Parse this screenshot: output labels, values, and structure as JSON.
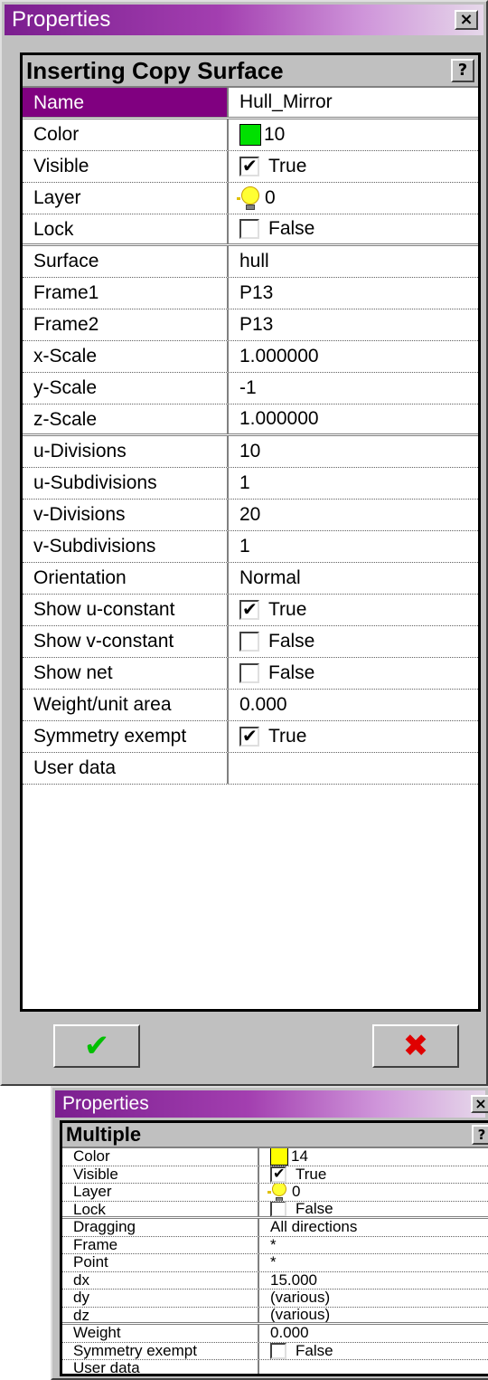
{
  "window1": {
    "title": "Properties",
    "close_label": "×",
    "header_title": "Inserting Copy Surface",
    "help_label": "?",
    "rows": [
      {
        "name": "Name",
        "value": "Hull_Mirror"
      },
      {
        "name": "Color",
        "value": "10",
        "swatch": "#00e000"
      },
      {
        "name": "Visible",
        "value": "True",
        "checked": true
      },
      {
        "name": "Layer",
        "value": "0"
      },
      {
        "name": "Lock",
        "value": "False",
        "checked": false
      },
      {
        "name": "Surface",
        "value": "hull"
      },
      {
        "name": "Frame1",
        "value": "P13"
      },
      {
        "name": "Frame2",
        "value": "P13"
      },
      {
        "name": "x-Scale",
        "value": "1.000000"
      },
      {
        "name": "y-Scale",
        "value": "-1"
      },
      {
        "name": "z-Scale",
        "value": "1.000000"
      },
      {
        "name": "u-Divisions",
        "value": "10"
      },
      {
        "name": "u-Subdivisions",
        "value": "1"
      },
      {
        "name": "v-Divisions",
        "value": "20"
      },
      {
        "name": "v-Subdivisions",
        "value": "1"
      },
      {
        "name": "Orientation",
        "value": "Normal"
      },
      {
        "name": "Show u-constant",
        "value": "True",
        "checked": true
      },
      {
        "name": "Show v-constant",
        "value": "False",
        "checked": false
      },
      {
        "name": "Show net",
        "value": "False",
        "checked": false
      },
      {
        "name": "Weight/unit area",
        "value": "0.000"
      },
      {
        "name": "Symmetry exempt",
        "value": "True",
        "checked": true
      },
      {
        "name": "User data",
        "value": ""
      }
    ],
    "ok_icon": "checkmark-icon",
    "cancel_icon": "x-icon",
    "ok_color": "#00c000",
    "cancel_color": "#e00000"
  },
  "window2": {
    "title": "Properties",
    "close_label": "×",
    "header_title": "Multiple",
    "help_label": "?",
    "rows": [
      {
        "name": "Color",
        "value": "14",
        "swatch": "#ffff00"
      },
      {
        "name": "Visible",
        "value": "True",
        "checked": true
      },
      {
        "name": "Layer",
        "value": "0"
      },
      {
        "name": "Lock",
        "value": "False",
        "checked": false
      },
      {
        "name": "Dragging",
        "value": "All directions"
      },
      {
        "name": "Frame",
        "value": "*"
      },
      {
        "name": "Point",
        "value": "*"
      },
      {
        "name": "dx",
        "value": "15.000"
      },
      {
        "name": "dy",
        "value": "(various)"
      },
      {
        "name": "dz",
        "value": "(various)"
      },
      {
        "name": "Weight",
        "value": "0.000"
      },
      {
        "name": "Symmetry exempt",
        "value": "False",
        "checked": false
      },
      {
        "name": "User data",
        "value": ""
      }
    ]
  },
  "colors": {
    "selected_row": "#800080",
    "title_bar": "#7b1e8f"
  }
}
